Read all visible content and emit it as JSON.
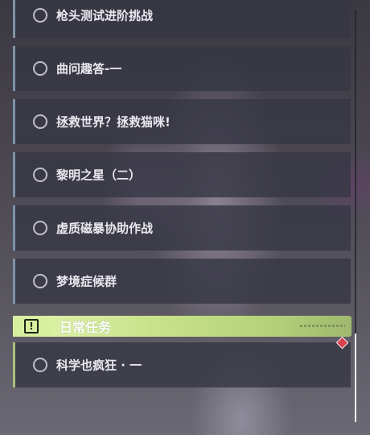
{
  "quests": [
    {
      "label": "枪头测试进阶挑战",
      "status_icon": "circle-icon"
    },
    {
      "label": "曲问趣答-一",
      "status_icon": "circle-icon"
    },
    {
      "label": "拯救世界？拯救猫咪!",
      "status_icon": "circle-icon"
    },
    {
      "label": "黎明之星（二）",
      "status_icon": "circle-icon"
    },
    {
      "label": "虚质磁暴协助作战",
      "status_icon": "circle-icon"
    },
    {
      "label": "梦境症候群",
      "status_icon": "circle-icon"
    }
  ],
  "daily": {
    "title": "日常任务",
    "header_icon": "alert-icon",
    "items": [
      {
        "label": "科学也疯狂 · 一",
        "status_icon": "circle-icon"
      }
    ]
  },
  "colors": {
    "quest_accent": "#7d93a6",
    "daily_accent": "#a8c27a",
    "daily_header": "#c9e38c",
    "new_marker": "#d9414f"
  },
  "scroll_position": 0.78
}
